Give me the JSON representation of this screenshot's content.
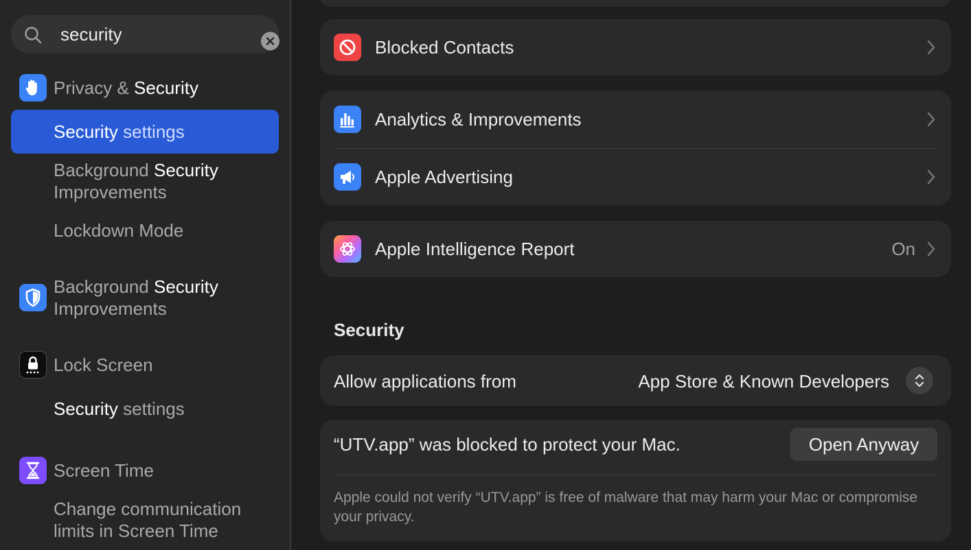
{
  "search": {
    "value": "security",
    "placeholder": "Search"
  },
  "sidebar": {
    "privacy": {
      "pre": "Privacy & ",
      "hl": "Security"
    },
    "selected": {
      "hl": "Security",
      "post": " settings"
    },
    "bg_sub": {
      "pre": "Background ",
      "hl": "Security",
      "post": "Improvements"
    },
    "lockdown": "Lockdown Mode",
    "bg_main": {
      "pre": "Background ",
      "hl": "Security",
      "post": "Improvements"
    },
    "lock_screen": "Lock Screen",
    "lock_sub": {
      "hl": "Security",
      "post": " settings"
    },
    "screen_time": "Screen Time",
    "comm_limits": {
      "line1": "Change communication",
      "line2": "limits in Screen Time"
    }
  },
  "main": {
    "blocked_contacts": "Blocked Contacts",
    "analytics": "Analytics & Improvements",
    "advertising": "Apple Advertising",
    "intelligence": {
      "label": "Apple Intelligence Report",
      "value": "On"
    },
    "security_title": "Security",
    "allow": {
      "label": "Allow applications from",
      "value": "App Store & Known Developers"
    },
    "blocked": {
      "message": "“UTV.app” was blocked to protect your Mac.",
      "button": "Open Anyway",
      "warning": "Apple could not verify “UTV.app” is free of malware that may harm your Mac or compromise your privacy."
    }
  },
  "colors": {
    "accent": "#2a5bd7",
    "privacy_icon": "#3b82f6",
    "blocked_icon": "#ef4444",
    "screen_time_icon": "#7c4dff"
  }
}
